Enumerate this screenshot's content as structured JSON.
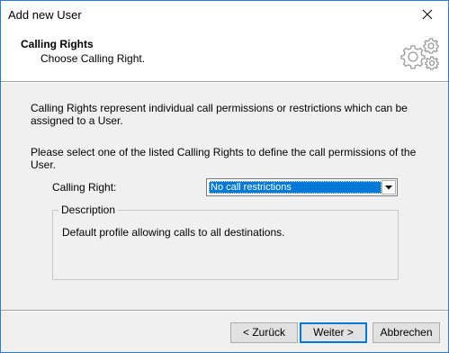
{
  "window": {
    "title": "Add new User",
    "close_glyph": "✕"
  },
  "header": {
    "title": "Calling Rights",
    "subtitle": "Choose Calling Right.",
    "icon": "gears-icon"
  },
  "content": {
    "intro": "Calling Rights represent individual call permissions or restrictions which can be assigned to a User.",
    "instruction": "Please select one of the listed Calling Rights to define the call permissions of the User.",
    "calling_right_label": "Calling Right:",
    "calling_right_value": "No call restrictions",
    "description_legend": "Description",
    "description_text": "Default profile allowing calls to all destinations."
  },
  "buttons": {
    "back": "< Zurück",
    "next": "Weiter >",
    "cancel": "Abbrechen"
  },
  "colors": {
    "accent": "#0078d7",
    "window_border": "#2b7bd6",
    "dialog_bg": "#f0f0f0"
  }
}
